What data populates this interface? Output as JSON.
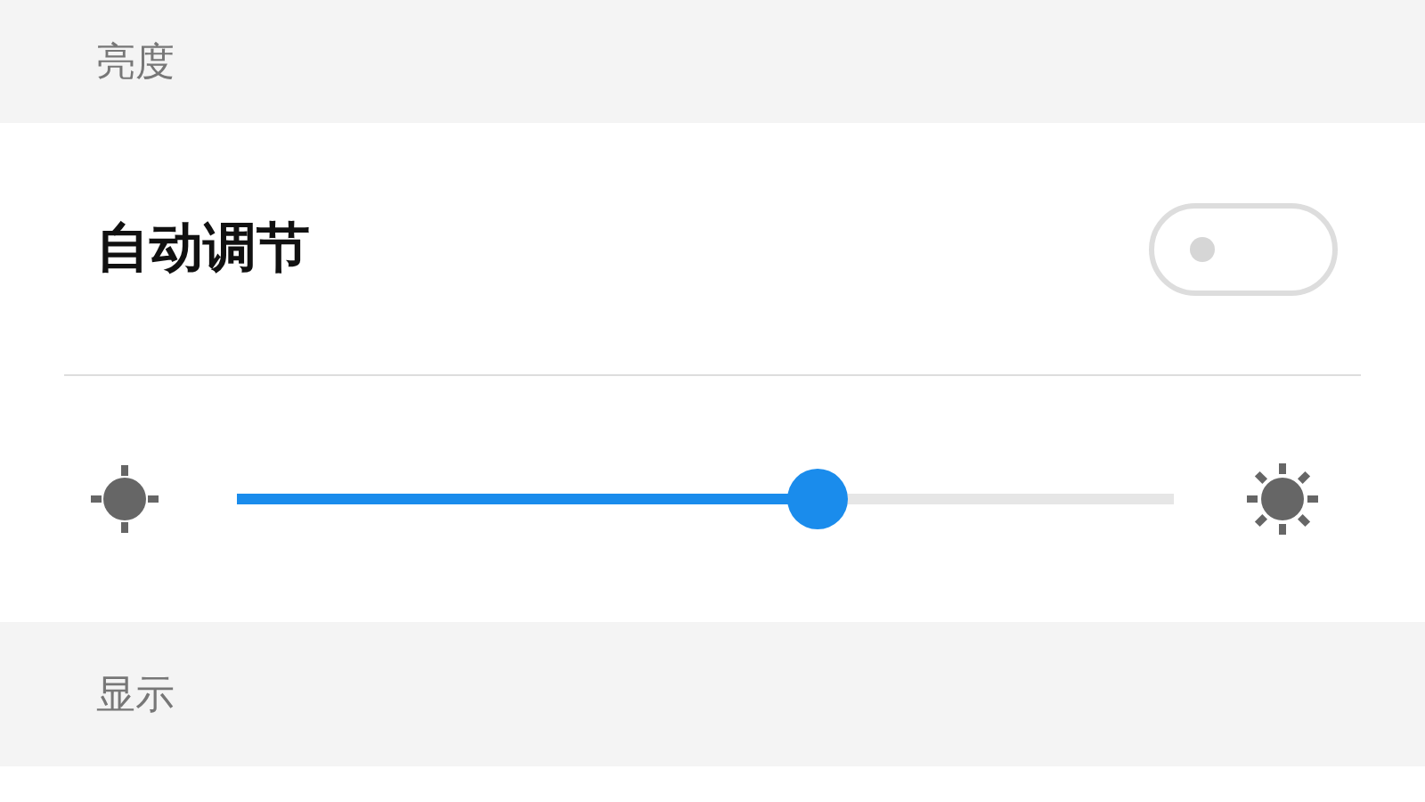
{
  "sections": [
    {
      "title": "亮度"
    },
    {
      "title": "显示"
    }
  ],
  "auto_adjust": {
    "label": "自动调节",
    "on": false
  },
  "brightness": {
    "level": 0.62
  }
}
